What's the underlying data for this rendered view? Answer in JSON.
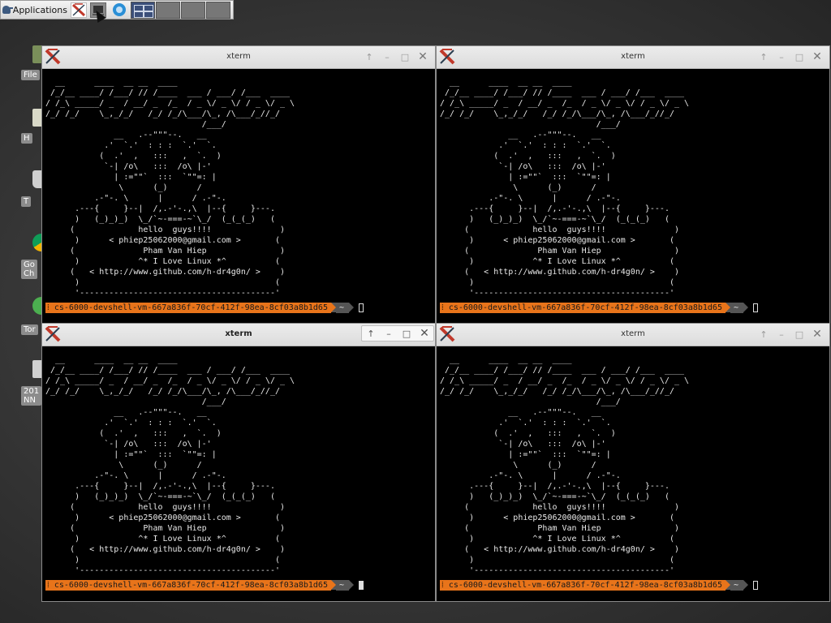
{
  "panel": {
    "applications_label": "Applications",
    "launchers": [
      "xterm-icon",
      "terminal-icon",
      "web-browser-icon"
    ],
    "workspaces": 4,
    "active_workspace": 1
  },
  "desktop": {
    "icons": [
      {
        "label": "File",
        "icon": "folder-icon"
      },
      {
        "label": "H",
        "icon": "home-icon"
      },
      {
        "label": "T",
        "icon": "trash-icon"
      },
      {
        "label": "Go\nCh",
        "icon": "chrome-icon"
      },
      {
        "label": "Tor",
        "icon": "tor-icon"
      },
      {
        "label": "201\nNN",
        "icon": "document-icon"
      }
    ]
  },
  "colors": {
    "prompt_host_bg": "#e8741a",
    "prompt_dir_bg": "#555555",
    "terminal_bg": "#000000",
    "terminal_fg": "#e8e8e8"
  },
  "windows": [
    {
      "title": "xterm",
      "focused": false
    },
    {
      "title": "xterm",
      "focused": false
    },
    {
      "title": "xterm",
      "focused": true
    },
    {
      "title": "xterm",
      "focused": false
    }
  ],
  "terminal": {
    "banner": "  __      ____  __ __  ____\n /_/__ ____/ /___/ // /____  ___ / ___/ /___  ____\n/ /_\\ _____/ _  / __/ _  /_  / _ \\/ _ \\/ / _ \\/ _ \\\n/_/ /_/    \\_,_/_/   /_/ /_/\\___/\\_, /\\___/_//_/\n                                /___/",
    "art": "              __   .--\"\"\"--.   __\n            .'  `.'  : : :  `.'  `.\n           (  .'  ,   :::   ,  `.  )\n            `-| /o\\   :::  /o\\ |-'\n              | :=\"\"`  :::  `\"\"=: |\n               \\      (_)      /\n          .-\"-. \\      |      / .-\"-.\n      .---{     }--|  /,.-'-.,\\  |--{     }---.\n      )   (_)_)_)  \\_/`~-===-~`\\_/  (_(_(_)   (\n     (             hello  guys!!!!              )\n      )      < phiep25062000@gmail.com >       (\n     (              Pham Van Hiep               )\n      )            ^* I Love Linux *^          (\n     (   < http://www.github.com/h-dr4g0n/ >    )\n      )                                        (\n      '----------------------------------------'",
    "prompt_host": "cs-6000-devshell-vm-667a836f-70cf-412f-98ea-8cf03a8b1d65",
    "prompt_dir": "~"
  }
}
